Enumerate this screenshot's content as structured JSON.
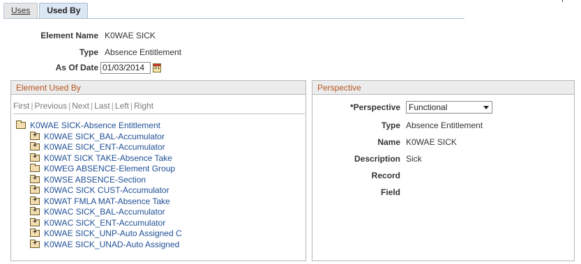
{
  "tabs": [
    {
      "label": "Uses",
      "active": false
    },
    {
      "label": "Used By",
      "active": true
    }
  ],
  "header": {
    "element_name_label": "Element Name",
    "element_name_value": "K0WAE SICK",
    "type_label": "Type",
    "type_value": "Absence Entitlement",
    "as_of_date_label": "As Of Date",
    "as_of_date_value": "01/03/2014"
  },
  "element_used_by": {
    "title": "Element Used By",
    "nav": [
      "First",
      "Previous",
      "Next",
      "Last",
      "Left",
      "Right"
    ],
    "root": "K0WAE SICK-Absence Entitlement",
    "children": [
      {
        "label": "K0WAE SICK_BAL-Accumulator",
        "icon": "folder-plus-icon"
      },
      {
        "label": "K0WAE SICK_ENT-Accumulator",
        "icon": "folder-plus-icon"
      },
      {
        "label": "K0WAT SICK TAKE-Absence Take",
        "icon": "folder-plus-icon"
      },
      {
        "label": "K0WEG ABSENCE-Element Group",
        "icon": "folder-open-icon"
      },
      {
        "label": "K0WSE ABSENCE-Section",
        "icon": "folder-plus-icon"
      },
      {
        "label": "K0WAC SICK CUST-Accumulator",
        "icon": "folder-plus-icon"
      },
      {
        "label": "K0WAT FMLA MAT-Absence Take",
        "icon": "folder-plus-icon"
      },
      {
        "label": "K0WAC SICK_BAL-Accumulator",
        "icon": "folder-plus-icon"
      },
      {
        "label": "K0WAC SICK_ENT-Accumulator",
        "icon": "folder-plus-icon"
      },
      {
        "label": "K0WAE SICK_UNP-Auto Assigned C",
        "icon": "folder-plus-icon"
      },
      {
        "label": "K0WAE SICK_UNAD-Auto Assigned",
        "icon": "folder-plus-icon"
      }
    ]
  },
  "perspective": {
    "title": "Perspective",
    "perspective_label": "*Perspective",
    "perspective_value": "Functional",
    "type_label": "Type",
    "type_value": "Absence Entitlement",
    "name_label": "Name",
    "name_value": "K0WAE SICK",
    "description_label": "Description",
    "description_value": "Sick",
    "record_label": "Record",
    "record_value": "",
    "field_label": "Field",
    "field_value": ""
  }
}
